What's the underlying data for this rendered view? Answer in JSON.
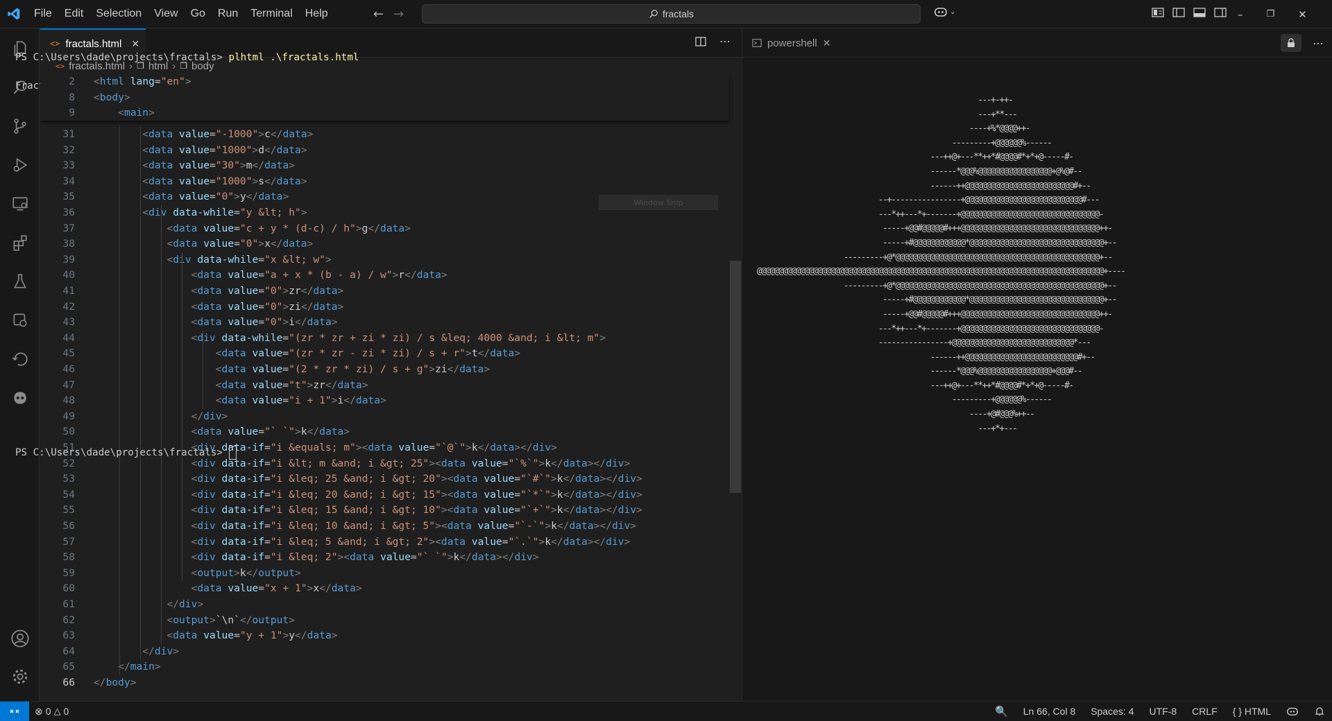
{
  "menu": [
    "File",
    "Edit",
    "Selection",
    "View",
    "Go",
    "Run",
    "Terminal",
    "Help"
  ],
  "search": {
    "text": "fractals"
  },
  "editor": {
    "tab_label": "fractals.html",
    "breadcrumb": [
      "fractals.html",
      "html",
      "body"
    ],
    "sticky_lines": [
      {
        "n": "2",
        "text": "<html lang=\"en\">"
      },
      {
        "n": "8",
        "text": "<body>"
      },
      {
        "n": "9",
        "text": "<main>"
      }
    ],
    "lines": [
      {
        "n": "31",
        "indent": 4,
        "text": "<data value=\"-1000\">c</data>"
      },
      {
        "n": "32",
        "indent": 4,
        "text": "<data value=\"1000\">d</data>"
      },
      {
        "n": "33",
        "indent": 4,
        "text": "<data value=\"30\">m</data>"
      },
      {
        "n": "34",
        "indent": 4,
        "text": "<data value=\"1000\">s</data>"
      },
      {
        "n": "35",
        "indent": 4,
        "text": "<data value=\"0\">y</data>"
      },
      {
        "n": "36",
        "indent": 4,
        "text": "<div data-while=\"y &lt; h\">"
      },
      {
        "n": "37",
        "indent": 6,
        "text": "<data value=\"c + y * (d-c) / h\">g</data>"
      },
      {
        "n": "38",
        "indent": 6,
        "text": "<data value=\"0\">x</data>"
      },
      {
        "n": "39",
        "indent": 6,
        "text": "<div data-while=\"x &lt; w\">"
      },
      {
        "n": "40",
        "indent": 8,
        "text": "<data value=\"a + x * (b - a) / w\">r</data>"
      },
      {
        "n": "41",
        "indent": 8,
        "text": "<data value=\"0\">zr</data>"
      },
      {
        "n": "42",
        "indent": 8,
        "text": "<data value=\"0\">zi</data>"
      },
      {
        "n": "43",
        "indent": 8,
        "text": "<data value=\"0\">i</data>"
      },
      {
        "n": "44",
        "indent": 8,
        "text": "<div data-while=\"(zr * zr + zi * zi) / s &leq; 4000 &and; i &lt; m\">"
      },
      {
        "n": "45",
        "indent": 10,
        "text": "<data value=\"(zr * zr - zi * zi) / s + r\">t</data>"
      },
      {
        "n": "46",
        "indent": 10,
        "text": "<data value=\"(2 * zr * zi) / s + g\">zi</data>"
      },
      {
        "n": "47",
        "indent": 10,
        "text": "<data value=\"t\">zr</data>"
      },
      {
        "n": "48",
        "indent": 10,
        "text": "<data value=\"i + 1\">i</data>"
      },
      {
        "n": "49",
        "indent": 8,
        "text": "</div>"
      },
      {
        "n": "50",
        "indent": 8,
        "text": "<data value=\"` `\">k</data>"
      },
      {
        "n": "51",
        "indent": 8,
        "text": "<div data-if=\"i &equals; m\"><data value=\"`@`\">k</data></div>"
      },
      {
        "n": "52",
        "indent": 8,
        "text": "<div data-if=\"i &lt; m &and; i &gt; 25\"><data value=\"`%`\">k</data></div>"
      },
      {
        "n": "53",
        "indent": 8,
        "text": "<div data-if=\"i &leq; 25 &and; i &gt; 20\"><data value=\"`#`\">k</data></div>"
      },
      {
        "n": "54",
        "indent": 8,
        "text": "<div data-if=\"i &leq; 20 &and; i &gt; 15\"><data value=\"`*`\">k</data></div>"
      },
      {
        "n": "55",
        "indent": 8,
        "text": "<div data-if=\"i &leq; 15 &and; i &gt; 10\"><data value=\"`+`\">k</data></div>"
      },
      {
        "n": "56",
        "indent": 8,
        "text": "<div data-if=\"i &leq; 10 &and; i &gt; 5\"><data value=\"`-`\">k</data></div>"
      },
      {
        "n": "57",
        "indent": 8,
        "text": "<div data-if=\"i &leq; 5 &and; i &gt; 2\"><data value=\"`.`\">k</data></div>"
      },
      {
        "n": "58",
        "indent": 8,
        "text": "<div data-if=\"i &leq; 2\"><data value=\"` `\">k</data></div>"
      },
      {
        "n": "59",
        "indent": 8,
        "text": "<output>k</output>"
      },
      {
        "n": "60",
        "indent": 8,
        "text": "<data value=\"x + 1\">x</data>"
      },
      {
        "n": "61",
        "indent": 6,
        "text": "</div>"
      },
      {
        "n": "62",
        "indent": 6,
        "text": "<output>`\\n`</output>"
      },
      {
        "n": "63",
        "indent": 6,
        "text": "<data value=\"y + 1\">y</data>"
      },
      {
        "n": "64",
        "indent": 4,
        "text": "</div>"
      },
      {
        "n": "65",
        "indent": 2,
        "text": "</main>"
      },
      {
        "n": "66",
        "indent": 0,
        "text": "</body>"
      }
    ],
    "snip_overlay": "Window Snip"
  },
  "terminal": {
    "tab_label": "powershell",
    "prompt": "PS C:\\Users\\dade\\projects\\fractals> ",
    "command": "plhtml .\\fractals.html",
    "output_title": "Fractals",
    "art": [
      "                                                   ---+-++-",
      "                                                   ---+**---",
      "                                                 ----+%*@@@@++-",
      "                                             ---------+@@@@@@%------",
      "                                        ---++@+---**++*#@@@@#*+*+@-----#-",
      "                                        ------*@@@%@@@@@@@@@@@@@@@@@+@%@#--",
      "                                        ------++@@@@@@@@@@@@@@@@@@@@@@@@@#+--",
      "                            --+----------------+@@@@@@@@@@@@@@@@@@@@@@@@@@@#---",
      "                            ---*++---*+-------+@@@@@@@@@@@@@@@@@@@@@@@@@@@@@@@@-",
      "                             -----+@@#@@@@@#+++@@@@@@@@@@@@@@@@@@@@@@@@@@@@@@@@++-",
      "                             -----+#@@@@@@@@@@@@*@@@@@@@@@@@@@@@@@@@@@@@@@@@@@@@+--",
      "                    ---------+@*@@@@@@@@@@@@@@@@@@@@@@@@@@@@@@@@@@@@@@@@@@@@@@@+--",
      "@@@@@@@@@@@@@@@@@@@@@@@@@@@@@@@@@@@@@@@@@@@@@@@@@@@@@@@@@@@@@@@@@@@@@@@@@@@@@@@@+----",
      "                    ---------+@*@@@@@@@@@@@@@@@@@@@@@@@@@@@@@@@@@@@@@@@@@@@@@@@@+--",
      "                             -----+#@@@@@@@@@@@@*@@@@@@@@@@@@@@@@@@@@@@@@@@@@@@@+--",
      "                             -----+@@#@@@@@#+++@@@@@@@@@@@@@@@@@@@@@@@@@@@@@@@@++-",
      "                            ---*++---*+-------+@@@@@@@@@@@@@@@@@@@@@@@@@@@@@@@@-",
      "                            ----------------+@@@@@@@@@@@@@@@@@@@@@@@@@@@@*---",
      "                                        ------++@@@@@@@@@@@@@@@@@@@@@@@@@@#+--",
      "                                        ------*@@@%@@@@@@@@@@@@@@@@@+@@@#--",
      "                                        ---++@+---**++*#@@@@#*+*+@-----#-",
      "                                             ---------+@@@@@@%------",
      "                                                 ----+@#@@@%++--",
      "                                                   ---+*+---"
    ]
  },
  "status": {
    "errors": "0",
    "warnings": "0",
    "position": "Ln 66, Col 8",
    "spaces": "Spaces: 4",
    "encoding": "UTF-8",
    "eol": "CRLF",
    "language": "HTML",
    "language_icon": "{ }"
  },
  "colors": {
    "accent": "#0078d4",
    "tag": "#569cd6",
    "attr": "#9cdcfe",
    "string": "#ce9178",
    "bracket": "#808080"
  }
}
